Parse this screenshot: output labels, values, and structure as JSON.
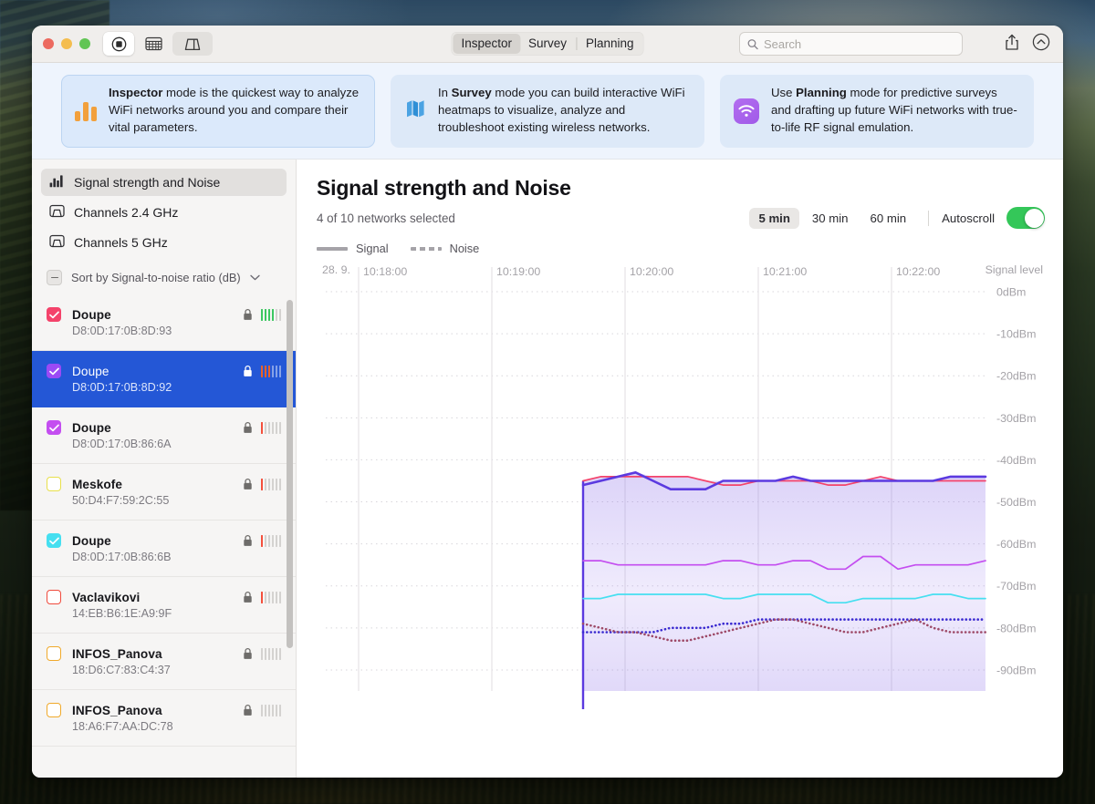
{
  "window": {
    "traffic_lights": [
      "close",
      "minimize",
      "zoom"
    ],
    "toolbar": {
      "buttons": [
        {
          "name": "record-stop-button",
          "icon": "stop-record-icon",
          "state": "active"
        },
        {
          "name": "table-view-button",
          "icon": "table-icon",
          "state": "plain"
        },
        {
          "name": "map-view-button",
          "icon": "floorplan-icon",
          "state": "shaded"
        }
      ],
      "tabs": [
        {
          "label": "Inspector",
          "selected": true
        },
        {
          "label": "Survey",
          "selected": false
        },
        {
          "label": "Planning",
          "selected": false
        }
      ],
      "search": {
        "value": "",
        "placeholder": "Search",
        "icon": "search-icon"
      },
      "share_icon": "share-icon",
      "collapse_icon": "chevron-up-circle-icon"
    }
  },
  "promos": [
    {
      "icon": "bar-chart-icon",
      "icon_color": "#f2a03c",
      "mode": "Inspector",
      "prefix": "",
      "suffix": " mode is the quickest way to analyze WiFi networks around you and compare their vital parameters."
    },
    {
      "icon": "map-icon",
      "icon_color": "#4ba3e3",
      "mode": "Survey",
      "prefix": "In ",
      "suffix": " mode you can build interactive WiFi heatmaps to visualize, analyze and troubleshoot existing wireless networks."
    },
    {
      "icon": "wifi-icon",
      "icon_color": "#a85fe8",
      "mode": "Planning",
      "prefix": "Use ",
      "suffix": " mode for predictive surveys and drafting up future WiFi networks with true-to-life RF signal emulation."
    }
  ],
  "sidebar": {
    "nav": [
      {
        "label": "Signal strength and Noise",
        "icon": "bar-chart-icon",
        "active": true
      },
      {
        "label": "Channels 2.4 GHz",
        "icon": "channel-chart-icon",
        "active": false
      },
      {
        "label": "Channels 5 GHz",
        "icon": "channel-chart-icon",
        "active": false
      }
    ],
    "sort": {
      "collapse_icon": "minus-icon",
      "label": "Sort by Signal-to-noise ratio (dB)",
      "chevron_icon": "chevron-down-icon"
    },
    "networks": [
      {
        "ssid": "Doupe",
        "mac": "D8:0D:17:0B:8D:93",
        "checked": true,
        "color": "#f4436b",
        "secured": true,
        "bars": 4,
        "bar_color": "#3cc761",
        "selected": false
      },
      {
        "ssid": "Doupe",
        "mac": "D8:0D:17:0B:8D:92",
        "checked": true,
        "color": "#9b4af5",
        "secured": true,
        "bars": 3,
        "bar_color": "#e8622a",
        "selected": true
      },
      {
        "ssid": "Doupe",
        "mac": "D8:0D:17:0B:86:6A",
        "checked": true,
        "color": "#c44ef0",
        "secured": true,
        "bars": 1,
        "bar_color": "#f4503c",
        "selected": false
      },
      {
        "ssid": "Meskofe",
        "mac": "50:D4:F7:59:2C:55",
        "checked": false,
        "color": "#e8e04a",
        "secured": true,
        "bars": 1,
        "bar_color": "#f4503c",
        "selected": false
      },
      {
        "ssid": "Doupe",
        "mac": "D8:0D:17:0B:86:6B",
        "checked": true,
        "color": "#46dff0",
        "secured": true,
        "bars": 1,
        "bar_color": "#f4503c",
        "selected": false
      },
      {
        "ssid": "Vaclavikovi",
        "mac": "14:EB:B6:1E:A9:9F",
        "checked": false,
        "color": "#f04a3c",
        "secured": true,
        "bars": 1,
        "bar_color": "#f4503c",
        "selected": false
      },
      {
        "ssid": "INFOS_Panova",
        "mac": "18:D6:C7:83:C4:37",
        "checked": false,
        "color": "#f0a92a",
        "secured": true,
        "bars": 0,
        "bar_color": "#d2d0ce",
        "selected": false
      },
      {
        "ssid": "INFOS_Panova",
        "mac": "18:A6:F7:AA:DC:78",
        "checked": false,
        "color": "#f0a92a",
        "secured": true,
        "bars": 0,
        "bar_color": "#d2d0ce",
        "selected": false
      }
    ]
  },
  "main": {
    "title": "Signal strength and Noise",
    "subtitle": "4 of 10 networks selected",
    "time_ranges": [
      {
        "label": "5 min",
        "selected": true
      },
      {
        "label": "30 min",
        "selected": false
      },
      {
        "label": "60 min",
        "selected": false
      }
    ],
    "autoscroll": {
      "label": "Autoscroll",
      "on": true
    },
    "legend": [
      {
        "label": "Signal",
        "style": "solid"
      },
      {
        "label": "Noise",
        "style": "dashed"
      }
    ]
  },
  "chart_data": {
    "type": "line",
    "title": "Signal strength and Noise",
    "xlabel": "",
    "ylabel": "Signal level",
    "date_label": "28. 9.",
    "axis_corner_label": "Signal level",
    "grid": true,
    "legend_position": "top-left",
    "ylim": [
      -95,
      0
    ],
    "yticks": [
      0,
      -10,
      -20,
      -30,
      -40,
      -50,
      -60,
      -70,
      -80,
      -90
    ],
    "ytick_labels": [
      "0dBm",
      "-10dBm",
      "-20dBm",
      "-30dBm",
      "-40dBm",
      "-50dBm",
      "-60dBm",
      "-70dBm",
      "-80dBm",
      "-90dBm"
    ],
    "xticks": [
      "10:18:00",
      "10:19:00",
      "10:20:00",
      "10:21:00",
      "10:22:00"
    ],
    "xlim": [
      "10:17:35",
      "10:22:45"
    ],
    "data_start_time": "10:19:20",
    "series": [
      {
        "name": "Doupe D8:0D:17:0B:8D:93",
        "kind": "signal",
        "style": "solid",
        "color": "#f4436b",
        "values": [
          -45,
          -44,
          -44,
          -44,
          -44,
          -44,
          -44,
          -45,
          -46,
          -46,
          -45,
          -45,
          -45,
          -45,
          -46,
          -46,
          -45,
          -44,
          -45,
          -45,
          -45,
          -45,
          -45,
          -45
        ]
      },
      {
        "name": "Doupe D8:0D:17:0B:8D:92",
        "kind": "signal",
        "style": "solid",
        "color": "#5b3ae0",
        "values": [
          -46,
          -45,
          -44,
          -43,
          -45,
          -47,
          -47,
          -47,
          -45,
          -45,
          -45,
          -45,
          -44,
          -45,
          -45,
          -45,
          -45,
          -45,
          -45,
          -45,
          -45,
          -44,
          -44,
          -44
        ]
      },
      {
        "name": "Doupe D8:0D:17:0B:86:6A",
        "kind": "signal",
        "style": "solid",
        "color": "#c44ef0",
        "values": [
          -64,
          -64,
          -65,
          -65,
          -65,
          -65,
          -65,
          -65,
          -64,
          -64,
          -65,
          -65,
          -64,
          -64,
          -66,
          -66,
          -63,
          -63,
          -66,
          -65,
          -65,
          -65,
          -65,
          -64
        ]
      },
      {
        "name": "Doupe D8:0D:17:0B:86:6B",
        "kind": "signal",
        "style": "solid",
        "color": "#46dff0",
        "values": [
          -73,
          -73,
          -72,
          -72,
          -72,
          -72,
          -72,
          -72,
          -73,
          -73,
          -72,
          -72,
          -72,
          -72,
          -74,
          -74,
          -73,
          -73,
          -73,
          -73,
          -72,
          -72,
          -73,
          -73
        ]
      },
      {
        "name": "Noise D8:0D:17:0B:8D:92",
        "kind": "noise",
        "style": "dotted",
        "color": "#3a2ad0",
        "values": [
          -81,
          -81,
          -81,
          -81,
          -81,
          -80,
          -80,
          -80,
          -79,
          -79,
          -78,
          -78,
          -78,
          -78,
          -78,
          -78,
          -78,
          -78,
          -78,
          -78,
          -78,
          -78,
          -78,
          -78
        ]
      },
      {
        "name": "Noise D8:0D:17:0B:8D:93",
        "kind": "noise",
        "style": "dotted",
        "color": "#9e4a68",
        "values": [
          -79,
          -80,
          -81,
          -81,
          -82,
          -83,
          -83,
          -82,
          -81,
          -80,
          -79,
          -78,
          -78,
          -79,
          -80,
          -81,
          -81,
          -80,
          -79,
          -78,
          -80,
          -81,
          -81,
          -81
        ]
      }
    ]
  }
}
